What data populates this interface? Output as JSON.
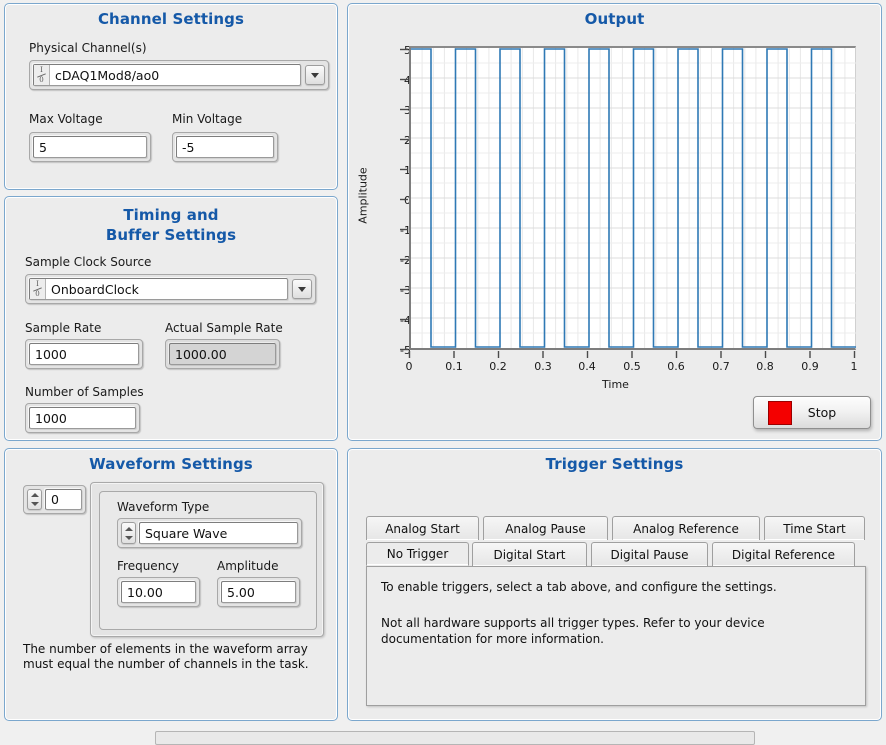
{
  "channel_settings": {
    "title": "Channel Settings",
    "physical_channel_label": "Physical Channel(s)",
    "physical_channel_value": "cDAQ1Mod8/ao0",
    "max_voltage_label": "Max Voltage",
    "max_voltage_value": "5",
    "min_voltage_label": "Min Voltage",
    "min_voltage_value": "-5"
  },
  "timing_settings": {
    "title_line1": "Timing and",
    "title_line2": "Buffer Settings",
    "sample_clock_source_label": "Sample Clock Source",
    "sample_clock_source_value": "OnboardClock",
    "sample_rate_label": "Sample Rate",
    "sample_rate_value": "1000",
    "actual_sample_rate_label": "Actual Sample Rate",
    "actual_sample_rate_value": "1000.00",
    "number_of_samples_label": "Number of Samples",
    "number_of_samples_value": "1000"
  },
  "waveform_settings": {
    "title": "Waveform Settings",
    "array_index_value": "0",
    "waveform_type_label": "Waveform Type",
    "waveform_type_value": "Square Wave",
    "frequency_label": "Frequency",
    "frequency_value": "10.00",
    "amplitude_label": "Amplitude",
    "amplitude_value": "5.00",
    "note_line1": "The number of elements in the waveform array",
    "note_line2": "must equal the number of channels in the task."
  },
  "output": {
    "title": "Output",
    "stop_label": "Stop",
    "stop_led_color": "#f40000"
  },
  "trigger_settings": {
    "title": "Trigger Settings",
    "tabs_row1": [
      "Analog Start",
      "Analog Pause",
      "Analog Reference",
      "Time Start"
    ],
    "tabs_row2": [
      "No Trigger",
      "Digital Start",
      "Digital Pause",
      "Digital Reference"
    ],
    "selected_tab": "No Trigger",
    "body_line1": "To enable triggers, select a tab above, and configure the settings.",
    "body_line2": "Not all hardware supports all trigger types. Refer to your device",
    "body_line3": "documentation for more information."
  },
  "theme": {
    "panel_border": "#7ba7cd",
    "panel_title_color": "#1559a8",
    "panel_fill": "#ececec",
    "plot_trace_color": "#2f79b5"
  },
  "chart_data": {
    "type": "line",
    "title": "Output",
    "xlabel": "Time",
    "ylabel": "Amplitude",
    "xlim": [
      0,
      1
    ],
    "ylim": [
      -5,
      5
    ],
    "xticks": [
      "0",
      "0.1",
      "0.2",
      "0.3",
      "0.4",
      "0.5",
      "0.6",
      "0.7",
      "0.8",
      "0.9",
      "1"
    ],
    "yticks": [
      "5",
      "4",
      "3",
      "2",
      "1",
      "0",
      "-1",
      "-2",
      "-3",
      "-4",
      "-5"
    ],
    "grid": true,
    "legend": "none",
    "waveform": {
      "shape": "square",
      "frequency_hz": 10,
      "amplitude": 5,
      "high_value": 5,
      "low_value": -5,
      "duty_cycle": 0.45,
      "cycles_shown": 10
    },
    "series": [
      {
        "name": "Output",
        "color": "#2f79b5",
        "x": [
          0,
          0.045,
          0.045,
          0.1,
          0.1,
          0.145,
          0.145,
          0.2,
          0.2,
          0.245,
          0.245,
          0.3,
          0.3,
          0.345,
          0.345,
          0.4,
          0.4,
          0.445,
          0.445,
          0.5,
          0.5,
          0.545,
          0.545,
          0.6,
          0.6,
          0.645,
          0.645,
          0.7,
          0.7,
          0.745,
          0.745,
          0.8,
          0.8,
          0.845,
          0.845,
          0.9,
          0.9,
          0.945,
          0.945,
          1.0
        ],
        "y": [
          5,
          5,
          -5,
          -5,
          5,
          5,
          -5,
          -5,
          5,
          5,
          -5,
          -5,
          5,
          5,
          -5,
          -5,
          5,
          5,
          -5,
          -5,
          5,
          5,
          -5,
          -5,
          5,
          5,
          -5,
          -5,
          5,
          5,
          -5,
          -5,
          5,
          5,
          -5,
          -5,
          5,
          5,
          -5,
          -5
        ]
      }
    ]
  }
}
